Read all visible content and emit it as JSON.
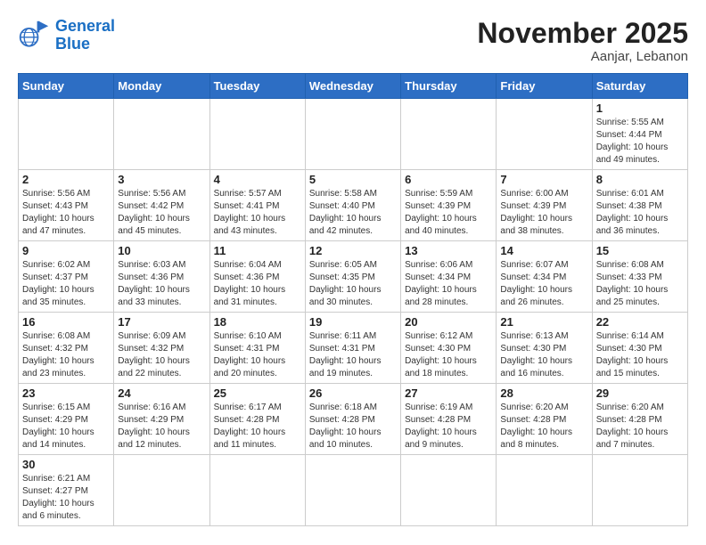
{
  "header": {
    "logo_general": "General",
    "logo_blue": "Blue",
    "month_title": "November 2025",
    "location": "Aanjar, Lebanon"
  },
  "weekdays": [
    "Sunday",
    "Monday",
    "Tuesday",
    "Wednesday",
    "Thursday",
    "Friday",
    "Saturday"
  ],
  "days": {
    "1": {
      "sunrise": "5:55 AM",
      "sunset": "4:44 PM",
      "daylight": "10 hours and 49 minutes."
    },
    "2": {
      "sunrise": "5:56 AM",
      "sunset": "4:43 PM",
      "daylight": "10 hours and 47 minutes."
    },
    "3": {
      "sunrise": "5:56 AM",
      "sunset": "4:42 PM",
      "daylight": "10 hours and 45 minutes."
    },
    "4": {
      "sunrise": "5:57 AM",
      "sunset": "4:41 PM",
      "daylight": "10 hours and 43 minutes."
    },
    "5": {
      "sunrise": "5:58 AM",
      "sunset": "4:40 PM",
      "daylight": "10 hours and 42 minutes."
    },
    "6": {
      "sunrise": "5:59 AM",
      "sunset": "4:39 PM",
      "daylight": "10 hours and 40 minutes."
    },
    "7": {
      "sunrise": "6:00 AM",
      "sunset": "4:39 PM",
      "daylight": "10 hours and 38 minutes."
    },
    "8": {
      "sunrise": "6:01 AM",
      "sunset": "4:38 PM",
      "daylight": "10 hours and 36 minutes."
    },
    "9": {
      "sunrise": "6:02 AM",
      "sunset": "4:37 PM",
      "daylight": "10 hours and 35 minutes."
    },
    "10": {
      "sunrise": "6:03 AM",
      "sunset": "4:36 PM",
      "daylight": "10 hours and 33 minutes."
    },
    "11": {
      "sunrise": "6:04 AM",
      "sunset": "4:36 PM",
      "daylight": "10 hours and 31 minutes."
    },
    "12": {
      "sunrise": "6:05 AM",
      "sunset": "4:35 PM",
      "daylight": "10 hours and 30 minutes."
    },
    "13": {
      "sunrise": "6:06 AM",
      "sunset": "4:34 PM",
      "daylight": "10 hours and 28 minutes."
    },
    "14": {
      "sunrise": "6:07 AM",
      "sunset": "4:34 PM",
      "daylight": "10 hours and 26 minutes."
    },
    "15": {
      "sunrise": "6:08 AM",
      "sunset": "4:33 PM",
      "daylight": "10 hours and 25 minutes."
    },
    "16": {
      "sunrise": "6:08 AM",
      "sunset": "4:32 PM",
      "daylight": "10 hours and 23 minutes."
    },
    "17": {
      "sunrise": "6:09 AM",
      "sunset": "4:32 PM",
      "daylight": "10 hours and 22 minutes."
    },
    "18": {
      "sunrise": "6:10 AM",
      "sunset": "4:31 PM",
      "daylight": "10 hours and 20 minutes."
    },
    "19": {
      "sunrise": "6:11 AM",
      "sunset": "4:31 PM",
      "daylight": "10 hours and 19 minutes."
    },
    "20": {
      "sunrise": "6:12 AM",
      "sunset": "4:30 PM",
      "daylight": "10 hours and 18 minutes."
    },
    "21": {
      "sunrise": "6:13 AM",
      "sunset": "4:30 PM",
      "daylight": "10 hours and 16 minutes."
    },
    "22": {
      "sunrise": "6:14 AM",
      "sunset": "4:30 PM",
      "daylight": "10 hours and 15 minutes."
    },
    "23": {
      "sunrise": "6:15 AM",
      "sunset": "4:29 PM",
      "daylight": "10 hours and 14 minutes."
    },
    "24": {
      "sunrise": "6:16 AM",
      "sunset": "4:29 PM",
      "daylight": "10 hours and 12 minutes."
    },
    "25": {
      "sunrise": "6:17 AM",
      "sunset": "4:28 PM",
      "daylight": "10 hours and 11 minutes."
    },
    "26": {
      "sunrise": "6:18 AM",
      "sunset": "4:28 PM",
      "daylight": "10 hours and 10 minutes."
    },
    "27": {
      "sunrise": "6:19 AM",
      "sunset": "4:28 PM",
      "daylight": "10 hours and 9 minutes."
    },
    "28": {
      "sunrise": "6:20 AM",
      "sunset": "4:28 PM",
      "daylight": "10 hours and 8 minutes."
    },
    "29": {
      "sunrise": "6:20 AM",
      "sunset": "4:28 PM",
      "daylight": "10 hours and 7 minutes."
    },
    "30": {
      "sunrise": "6:21 AM",
      "sunset": "4:27 PM",
      "daylight": "10 hours and 6 minutes."
    }
  },
  "labels": {
    "sunrise": "Sunrise:",
    "sunset": "Sunset:",
    "daylight": "Daylight:"
  }
}
